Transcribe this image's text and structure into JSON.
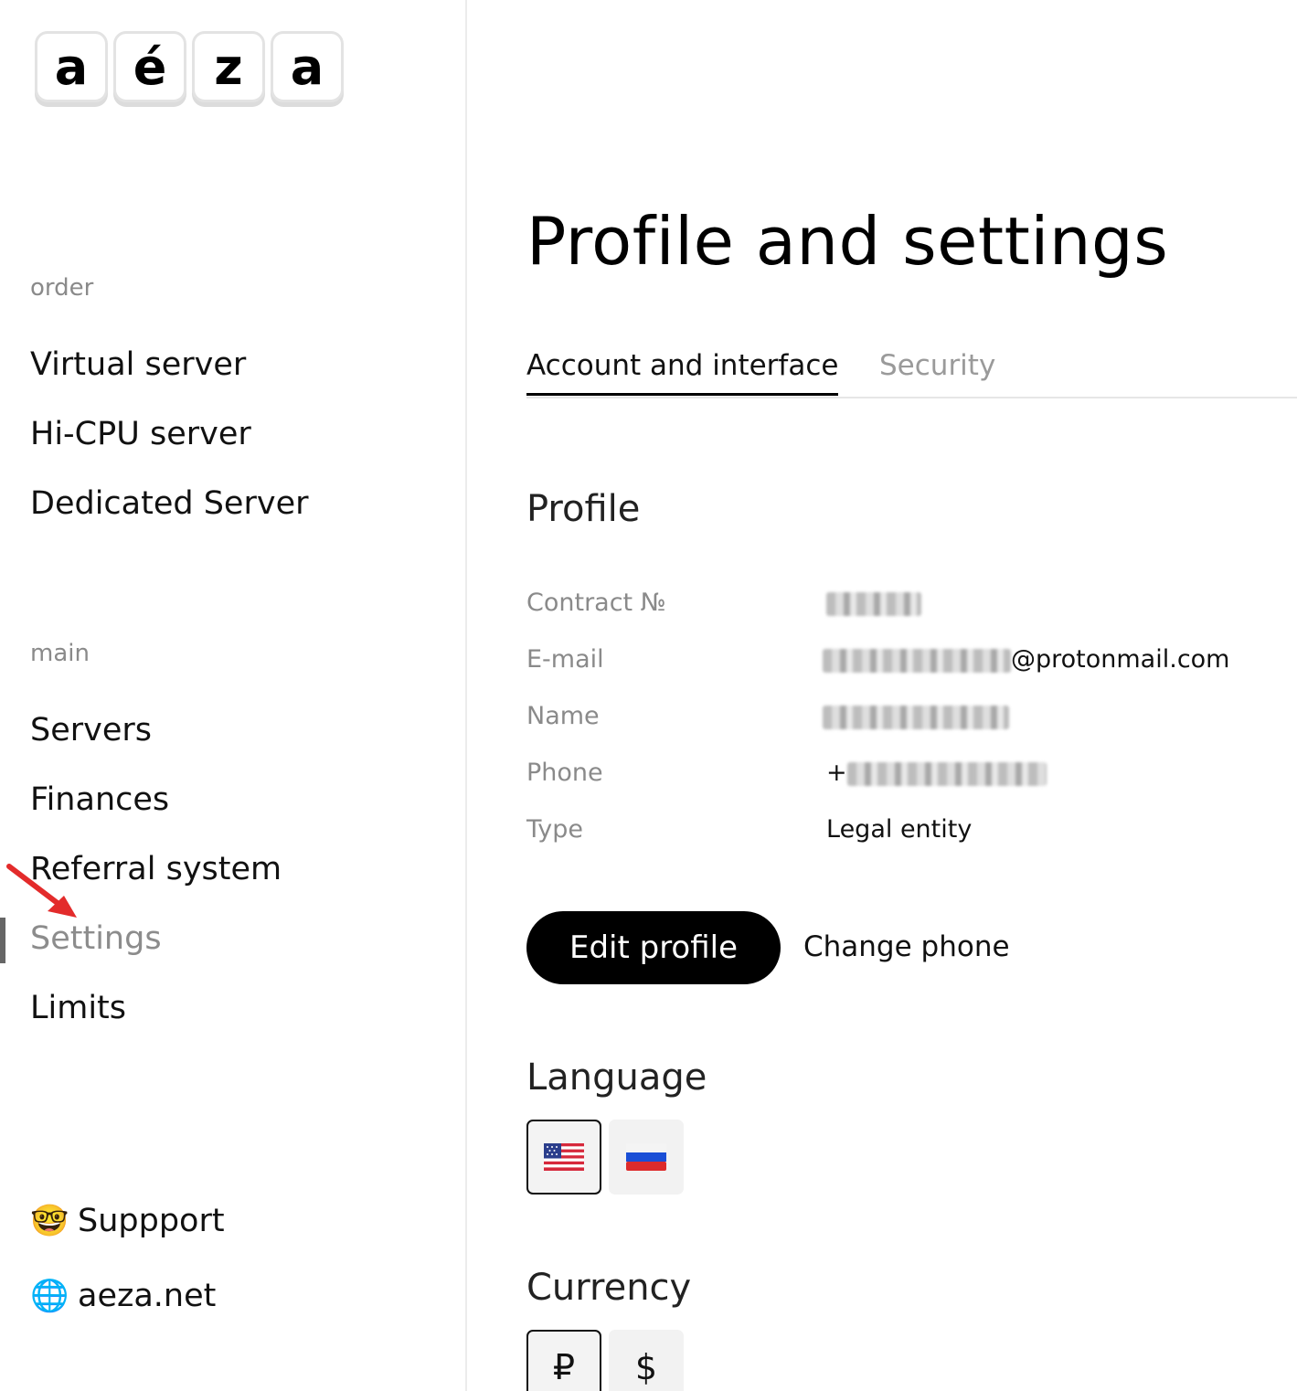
{
  "logo": {
    "letters": [
      "a",
      "é",
      "z",
      "a"
    ]
  },
  "sidebar": {
    "order_label": "order",
    "order_items": [
      {
        "label": "Virtual server"
      },
      {
        "label": "Hi-CPU server"
      },
      {
        "label": "Dedicated Server"
      }
    ],
    "main_label": "main",
    "main_items": [
      {
        "label": "Servers"
      },
      {
        "label": "Finances"
      },
      {
        "label": "Referral system"
      },
      {
        "label": "Settings",
        "active": true
      },
      {
        "label": "Limits"
      }
    ],
    "footer": [
      {
        "emoji": "🤓",
        "label": "Suppport"
      },
      {
        "emoji": "🌐",
        "label": "aeza.net"
      }
    ]
  },
  "main": {
    "title": "Profile and settings",
    "tabs": [
      {
        "label": "Account and interface",
        "active": true
      },
      {
        "label": "Security",
        "active": false
      }
    ],
    "profile": {
      "heading": "Profile",
      "fields": [
        {
          "label": "Contract №",
          "value": ""
        },
        {
          "label": "E-mail",
          "value": "@protonmail.com"
        },
        {
          "label": "Name",
          "value": ""
        },
        {
          "label": "Phone",
          "value": "+"
        },
        {
          "label": "Type",
          "value": "Legal entity"
        }
      ]
    },
    "buttons": {
      "edit_profile": "Edit profile",
      "change_phone": "Change phone"
    },
    "language": {
      "heading": "Language",
      "options": [
        {
          "icon": "us-flag-icon",
          "selected": true
        },
        {
          "icon": "ru-flag-icon",
          "selected": false
        }
      ]
    },
    "currency": {
      "heading": "Currency",
      "options": [
        {
          "symbol": "₽",
          "selected": true
        },
        {
          "symbol": "$",
          "selected": false
        }
      ]
    }
  },
  "colors": {
    "primary_button": "#000000",
    "muted_text": "#8a8a8a",
    "active_indicator": "#666666",
    "annotation_arrow": "#e32b2b"
  }
}
